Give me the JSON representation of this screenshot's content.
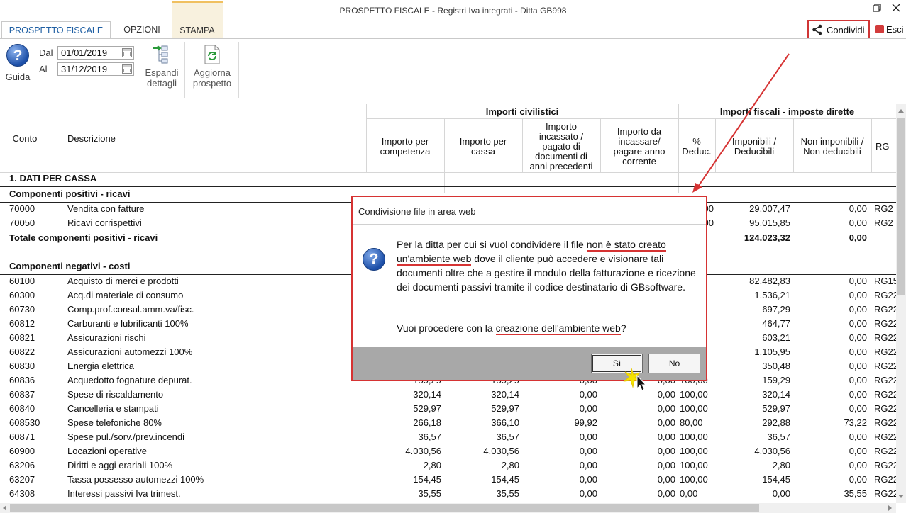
{
  "window": {
    "title": "PROSPETTO FISCALE - Registri Iva integrati - Ditta GB998",
    "restore_icon": "restore-icon",
    "close_icon": "close-icon"
  },
  "tabs": [
    {
      "label": "PROSPETTO FISCALE"
    },
    {
      "label": "OPZIONI"
    },
    {
      "label": "STAMPA"
    }
  ],
  "toolbar": {
    "share_label": "Condividi",
    "exit_label": "Esci",
    "help_label": "Guida",
    "from_label": "Dal",
    "to_label": "Al",
    "from_value": "01/01/2019",
    "to_value": "31/12/2019",
    "expand_label_1": "Espandi",
    "expand_label_2": "dettagli",
    "refresh_label_1": "Aggiorna",
    "refresh_label_2": "prospetto"
  },
  "table": {
    "group_civil": "Importi civilistici",
    "group_fiscal": "Importi fiscali - imposte dirette",
    "headers": {
      "conto": "Conto",
      "descrizione": "Descrizione",
      "competenza_1": "Importo per",
      "competenza_2": "competenza",
      "cassa_1": "Importo per",
      "cassa_2": "cassa",
      "incassato_1": "Importo",
      "incassato_2": "incassato /",
      "incassato_3": "pagato di",
      "incassato_4": "documenti di",
      "incassato_5": "anni precedenti",
      "daincassare_1": "Importo da",
      "daincassare_2": "incassare/",
      "daincassare_3": "pagare anno",
      "daincassare_4": "corrente",
      "deduc_1": "%",
      "deduc_2": "Deduc.",
      "imponibili_1": "Imponibili /",
      "imponibili_2": "Deducibili",
      "nonimponibili_1": "Non imponibili /",
      "nonimponibili_2": "Non deducibili",
      "rg": "RG"
    },
    "section_title": "1. DATI PER CASSA",
    "positive_title": "Componenti positivi - ricavi",
    "positive_rows": [
      {
        "conto": "70000",
        "desc": "Vendita con fatture",
        "d1": "00",
        "imp": "29.007,47",
        "nonimp": "0,00",
        "rg": "RG2"
      },
      {
        "conto": "70050",
        "desc": "Ricavi corrispettivi",
        "d1": "00",
        "imp": "95.015,85",
        "nonimp": "0,00",
        "rg": "RG2"
      }
    ],
    "positive_total": {
      "label": "Totale componenti positivi - ricavi",
      "imp": "124.023,32",
      "nonimp": "0,00"
    },
    "negative_title": "Componenti negativi - costi",
    "negative_rows": [
      {
        "conto": "60100",
        "desc": "Acquisto di merci e prodotti",
        "comp": "",
        "cassa": "",
        "inc": "",
        "dainc": "",
        "ded": "00",
        "imp": "82.482,83",
        "nonimp": "0,00",
        "rg": "RG15"
      },
      {
        "conto": "60300",
        "desc": "Acq.di materiale di consumo",
        "comp": "",
        "cassa": "",
        "inc": "",
        "dainc": "",
        "ded": "00",
        "imp": "1.536,21",
        "nonimp": "0,00",
        "rg": "RG22"
      },
      {
        "conto": "60730",
        "desc": "Comp.prof.consul.amm.va/fisc.",
        "comp": "",
        "cassa": "",
        "inc": "",
        "dainc": "",
        "ded": "00",
        "imp": "697,29",
        "nonimp": "0,00",
        "rg": "RG22"
      },
      {
        "conto": "60812",
        "desc": "Carburanti e lubrificanti 100%",
        "comp": "",
        "cassa": "",
        "inc": "",
        "dainc": "",
        "ded": "00",
        "imp": "464,77",
        "nonimp": "0,00",
        "rg": "RG22"
      },
      {
        "conto": "60821",
        "desc": "Assicurazioni rischi",
        "comp": "",
        "cassa": "",
        "inc": "",
        "dainc": "",
        "ded": "00",
        "imp": "603,21",
        "nonimp": "0,00",
        "rg": "RG22"
      },
      {
        "conto": "60822",
        "desc": "Assicurazioni automezzi 100%",
        "comp": "",
        "cassa": "",
        "inc": "",
        "dainc": "",
        "ded": "00",
        "imp": "1.105,95",
        "nonimp": "0,00",
        "rg": "RG22"
      },
      {
        "conto": "60830",
        "desc": "Energia elettrica",
        "comp": "",
        "cassa": "",
        "inc": "",
        "dainc": "",
        "ded": "00",
        "imp": "350,48",
        "nonimp": "0,00",
        "rg": "RG22"
      },
      {
        "conto": "60836",
        "desc": "Acquedotto fognature depurat.",
        "comp": "159,29",
        "cassa": "159,29",
        "inc": "0,00",
        "dainc": "0,00",
        "ded": "100,00",
        "imp": "159,29",
        "nonimp": "0,00",
        "rg": "RG22"
      },
      {
        "conto": "60837",
        "desc": "Spese di riscaldamento",
        "comp": "320,14",
        "cassa": "320,14",
        "inc": "0,00",
        "dainc": "0,00",
        "ded": "100,00",
        "imp": "320,14",
        "nonimp": "0,00",
        "rg": "RG22"
      },
      {
        "conto": "60840",
        "desc": "Cancelleria e stampati",
        "comp": "529,97",
        "cassa": "529,97",
        "inc": "0,00",
        "dainc": "0,00",
        "ded": "100,00",
        "imp": "529,97",
        "nonimp": "0,00",
        "rg": "RG22"
      },
      {
        "conto": "608530",
        "desc": "Spese telefoniche 80%",
        "comp": "266,18",
        "cassa": "366,10",
        "inc": "99,92",
        "dainc": "0,00",
        "ded": "80,00",
        "imp": "292,88",
        "nonimp": "73,22",
        "rg": "RG22"
      },
      {
        "conto": "60871",
        "desc": "Spese pul./sorv./prev.incendi",
        "comp": "36,57",
        "cassa": "36,57",
        "inc": "0,00",
        "dainc": "0,00",
        "ded": "100,00",
        "imp": "36,57",
        "nonimp": "0,00",
        "rg": "RG22"
      },
      {
        "conto": "60900",
        "desc": "Locazioni operative",
        "comp": "4.030,56",
        "cassa": "4.030,56",
        "inc": "0,00",
        "dainc": "0,00",
        "ded": "100,00",
        "imp": "4.030,56",
        "nonimp": "0,00",
        "rg": "RG22"
      },
      {
        "conto": "63206",
        "desc": "Diritti e aggi erariali 100%",
        "comp": "2,80",
        "cassa": "2,80",
        "inc": "0,00",
        "dainc": "0,00",
        "ded": "100,00",
        "imp": "2,80",
        "nonimp": "0,00",
        "rg": "RG22"
      },
      {
        "conto": "63207",
        "desc": "Tassa possesso automezzi 100%",
        "comp": "154,45",
        "cassa": "154,45",
        "inc": "0,00",
        "dainc": "0,00",
        "ded": "100,00",
        "imp": "154,45",
        "nonimp": "0,00",
        "rg": "RG22"
      },
      {
        "conto": "64308",
        "desc": "Interessi passivi Iva trimest.",
        "comp": "35,55",
        "cassa": "35,55",
        "inc": "0,00",
        "dainc": "0,00",
        "ded": "0,00",
        "imp": "0,00",
        "nonimp": "35,55",
        "rg": "RG22"
      }
    ]
  },
  "dialog": {
    "title": "Condivisione file in area web",
    "msg_1": "Per la ditta per cui si vuol condividere il file ",
    "msg_ul_1a": "non è stato creato",
    "msg_ul_1b": "un'ambiente web",
    "msg_2": " dove il cliente può accedere e visionare tali documenti oltre che a gestire il modulo della fatturazione e ricezione dei documenti passivi tramite il codice destinatario di GBsoftware.",
    "question_pre": "Vuoi procedere con la ",
    "question_ul": "creazione dell'ambiente web",
    "question_post": "?",
    "yes_label": "Sì",
    "no_label": "No"
  },
  "colors": {
    "accent_red": "#d63333",
    "tab_blue": "#1f5fa3"
  }
}
